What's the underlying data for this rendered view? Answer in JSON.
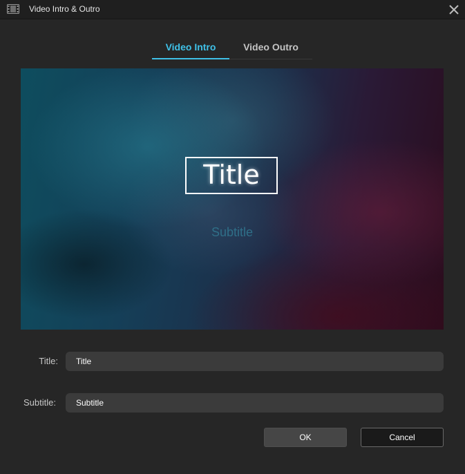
{
  "window": {
    "title": "Video Intro & Outro",
    "app_icon": "film-strip-icon",
    "close_icon": "close-icon"
  },
  "tabs": [
    {
      "label": "Video Intro",
      "active": true
    },
    {
      "label": "Video Outro",
      "active": false
    }
  ],
  "preview": {
    "title_text": "Title",
    "subtitle_text": "Subtitle"
  },
  "form": {
    "title_label": "Title:",
    "title_value": "Title",
    "subtitle_label": "Subtitle:",
    "subtitle_value": "Subtitle"
  },
  "buttons": {
    "ok_label": "OK",
    "cancel_label": "Cancel"
  },
  "colors": {
    "accent": "#3fc1e8",
    "background": "#262626",
    "input_background": "#3b3b3b"
  }
}
